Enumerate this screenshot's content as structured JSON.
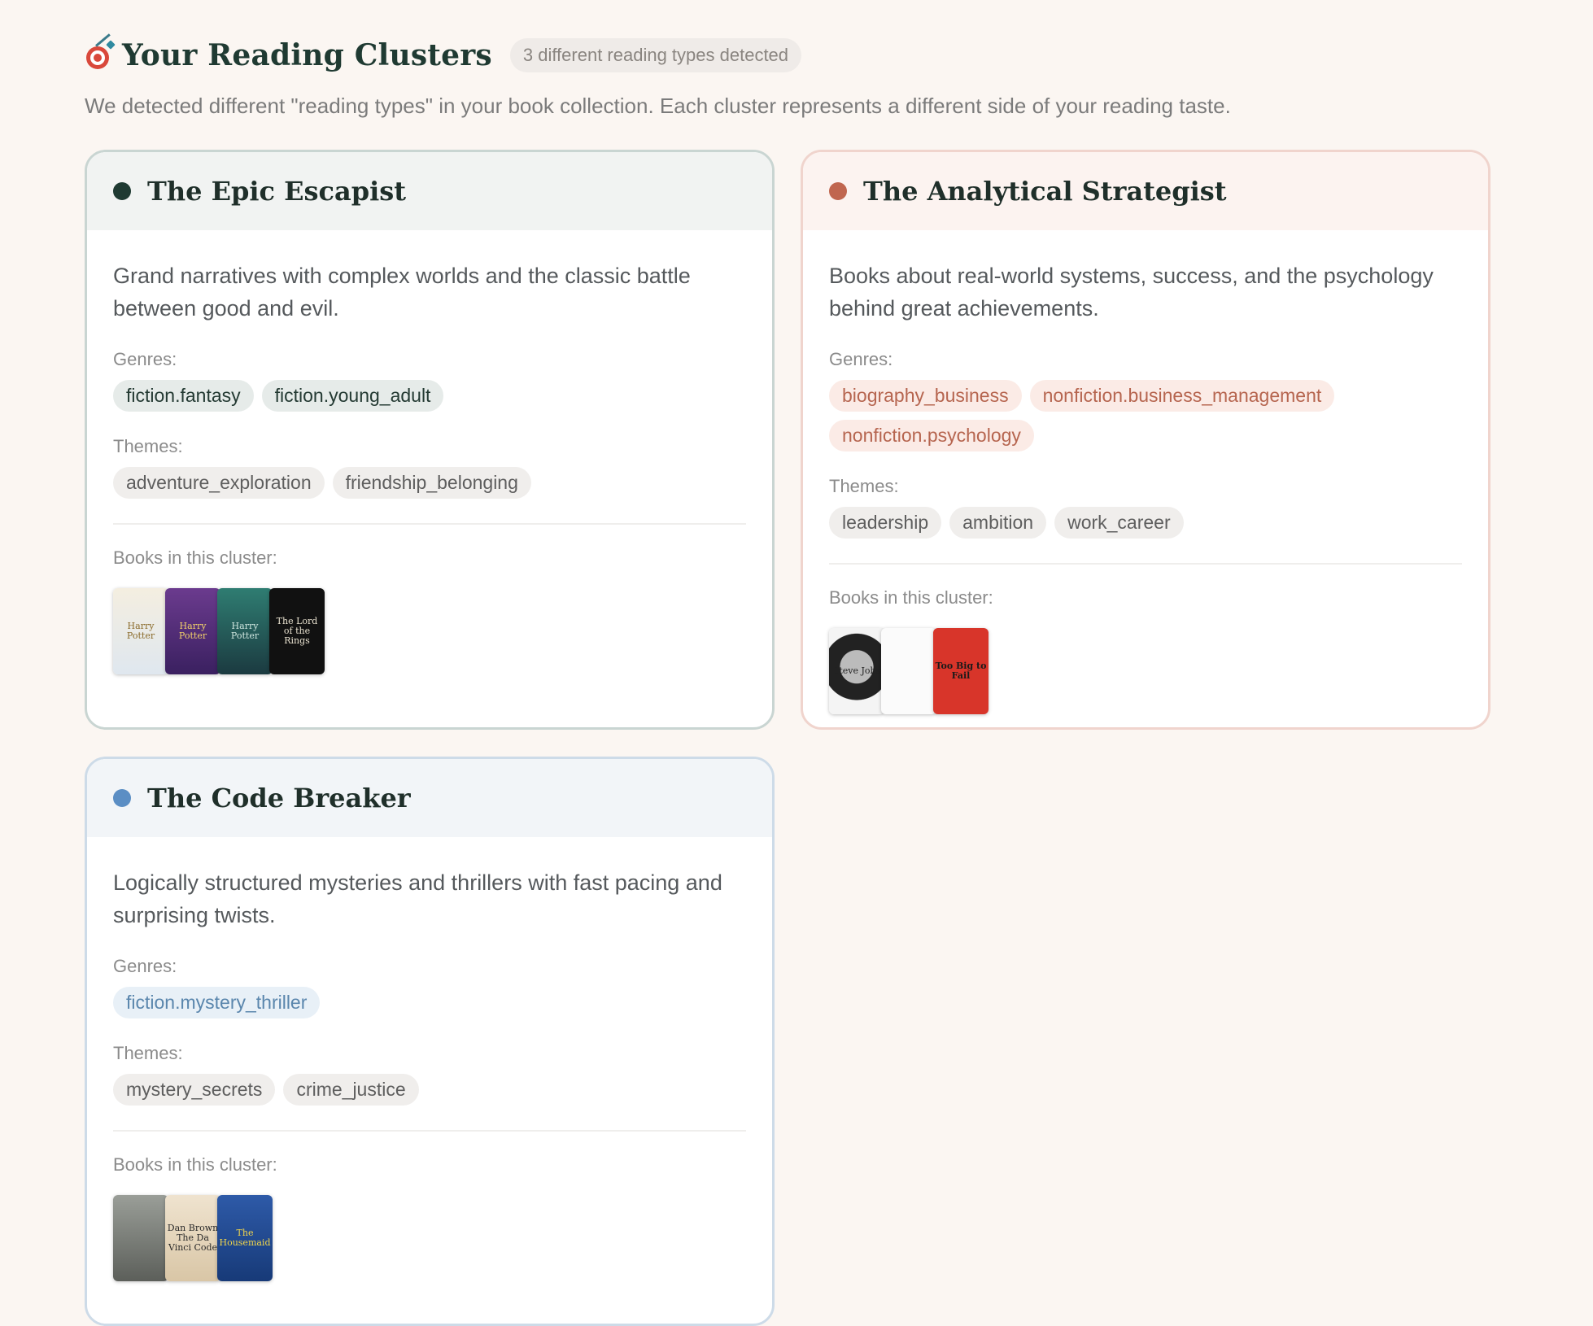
{
  "header": {
    "title": "Your Reading Clusters",
    "badge": "3 different reading types detected",
    "subtitle": "We detected different \"reading types\" in your book collection. Each cluster represents a different side of your reading taste.",
    "icon": "target-icon"
  },
  "labels": {
    "genres": "Genres:",
    "themes": "Themes:",
    "books": "Books in this cluster:"
  },
  "clusters": [
    {
      "title": "The Epic Escapist",
      "color": "#1f3a32",
      "description": "Grand narratives with complex worlds and the classic battle between good and evil.",
      "genres": [
        "fiction.fantasy",
        "fiction.young_adult"
      ],
      "themes": [
        "adventure_exploration",
        "friendship_belonging"
      ],
      "covers": [
        "Harry Potter",
        "Harry Potter",
        "Harry Potter",
        "The Lord of the Rings"
      ]
    },
    {
      "title": "The Analytical Strategist",
      "color": "#c0664f",
      "description": "Books about real-world systems, success, and the psychology behind great achievements.",
      "genres": [
        "biography_business",
        "nonfiction.business_management",
        "nonfiction.psychology"
      ],
      "themes": [
        "leadership",
        "ambition",
        "work_career"
      ],
      "covers": [
        "Steve Jobs",
        "",
        "Too Big to Fail"
      ]
    },
    {
      "title": "The Code Breaker",
      "color": "#5b8ec4",
      "description": "Logically structured mysteries and thrillers with fast pacing and surprising twists.",
      "genres": [
        "fiction.mystery_thriller"
      ],
      "themes": [
        "mystery_secrets",
        "crime_justice"
      ],
      "covers": [
        "",
        "Dan Brown The Da Vinci Code",
        "The Housemaid"
      ]
    }
  ]
}
